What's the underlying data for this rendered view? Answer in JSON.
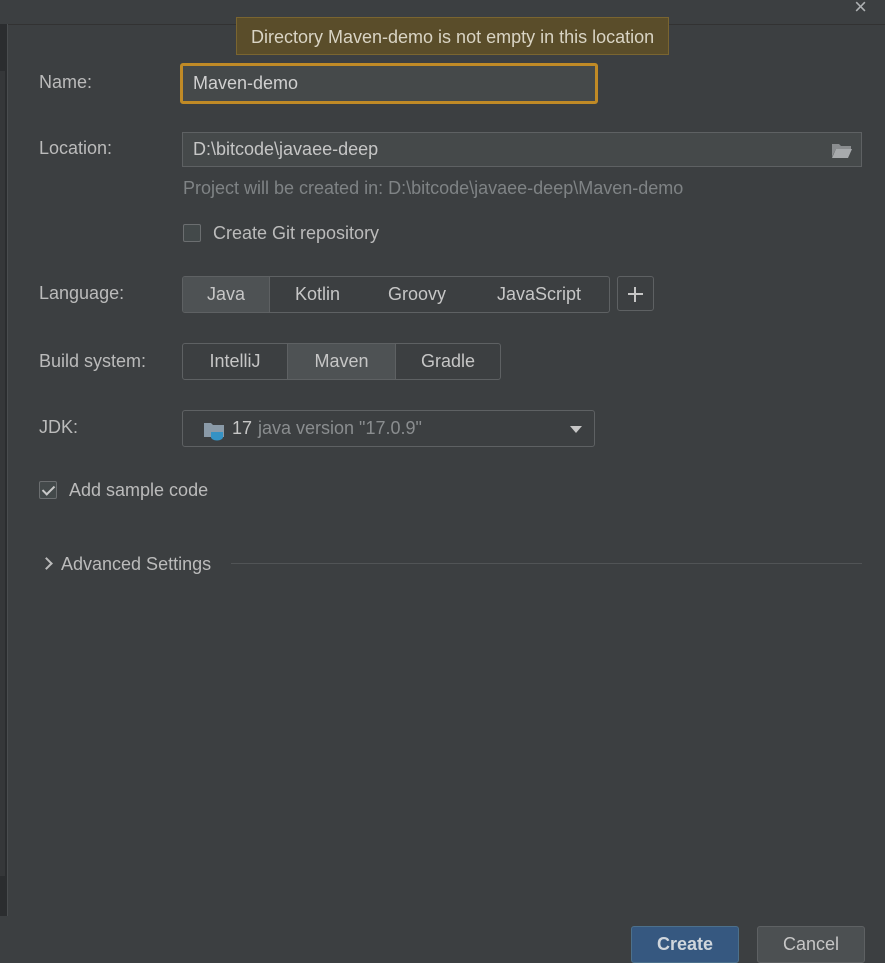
{
  "dialog": {
    "close_icon": "close-icon"
  },
  "tooltip": {
    "text": "Directory Maven-demo is not empty in this location"
  },
  "name": {
    "label": "Name:",
    "value": "Maven-demo"
  },
  "location": {
    "label": "Location:",
    "value": "D:\\bitcode\\javaee-deep",
    "hint": "Project will be created in: D:\\bitcode\\javaee-deep\\Maven-demo",
    "browse_icon": "folder-open-icon"
  },
  "git": {
    "label": "Create Git repository",
    "checked": false
  },
  "language": {
    "label": "Language:",
    "options": [
      "Java",
      "Kotlin",
      "Groovy",
      "JavaScript"
    ],
    "selected": "Java",
    "add_icon": "plus-icon"
  },
  "build_system": {
    "label": "Build system:",
    "options": [
      "IntelliJ",
      "Maven",
      "Gradle"
    ],
    "selected": "Maven"
  },
  "jdk": {
    "label": "JDK:",
    "version": "17",
    "detail": "java version \"17.0.9\"",
    "icon": "jdk-folder-icon"
  },
  "sample_code": {
    "label": "Add sample code",
    "checked": true
  },
  "advanced": {
    "label": "Advanced Settings",
    "expanded": false
  },
  "footer": {
    "create_label": "Create",
    "cancel_label": "Cancel"
  },
  "colors": {
    "focus_border": "#c08a26",
    "primary_button": "#365880",
    "background": "#3c3f41"
  }
}
